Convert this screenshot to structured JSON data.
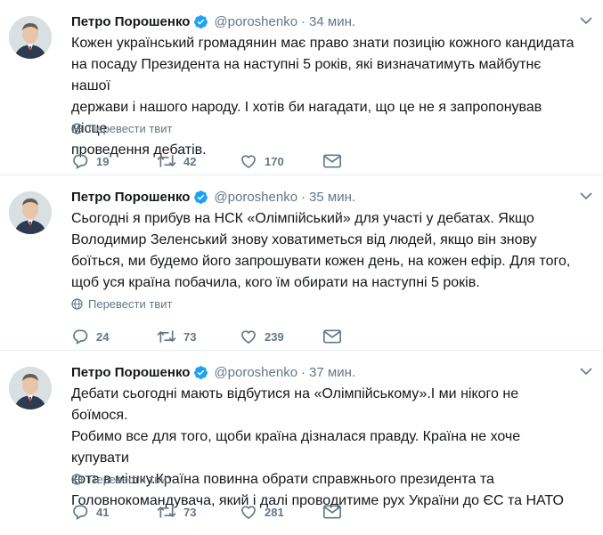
{
  "tweets": [
    {
      "author": "Петро Порошенко",
      "handle": "@poroshenko",
      "separator": "·",
      "time": "34 мин.",
      "text": "Кожен український громадянин має право знати позицію кожного кандидата\nна посаду Президента на наступні 5 років, які визначатимуть майбутнє нашої\nдержави і нашого народу. І хотів би нагадати, що це не я запропонував місце\nпроведення дебатів.",
      "translate": "Перевести твит",
      "replies": "19",
      "retweets": "42",
      "likes": "170"
    },
    {
      "author": "Петро Порошенко",
      "handle": "@poroshenko",
      "separator": "·",
      "time": "35 мин.",
      "text": "Сьогодні я прибув на НСК «Олімпійський» для участі у дебатах. Якщо\nВолодимир Зеленський знову ховатиметься від людей, якщо він знову\nбоїться, ми будемо його запрошувати кожен день, на кожен ефір. Для того,\nщоб уся країна побачила, кого їм обирати на наступні 5 років.",
      "translate": "Перевести твит",
      "replies": "24",
      "retweets": "73",
      "likes": "239"
    },
    {
      "author": "Петро Порошенко",
      "handle": "@poroshenko",
      "separator": "·",
      "time": "37 мин.",
      "text": "Дебати сьогодні мають відбутися на «Олімпійському».І ми нікого не боїмося.\nРобимо все для того, щоби країна дізналася правду. Країна не хоче купувати\nкота в мішку.Країна повинна обрати справжнього президента та\nГоловнокомандувача, який і далі проводитиме рух України до ЄС та НАТО",
      "translate": "Перевести твит",
      "replies": "41",
      "retweets": "73",
      "likes": "281"
    }
  ],
  "colors": {
    "text": "#14171a",
    "secondary": "#657786",
    "verified": "#1da1f2",
    "divider": "#e6ecf0"
  },
  "icons": [
    "verified-badge-icon",
    "chevron-down-icon",
    "globe-icon",
    "reply-icon",
    "retweet-icon",
    "like-icon",
    "direct-message-icon"
  ]
}
